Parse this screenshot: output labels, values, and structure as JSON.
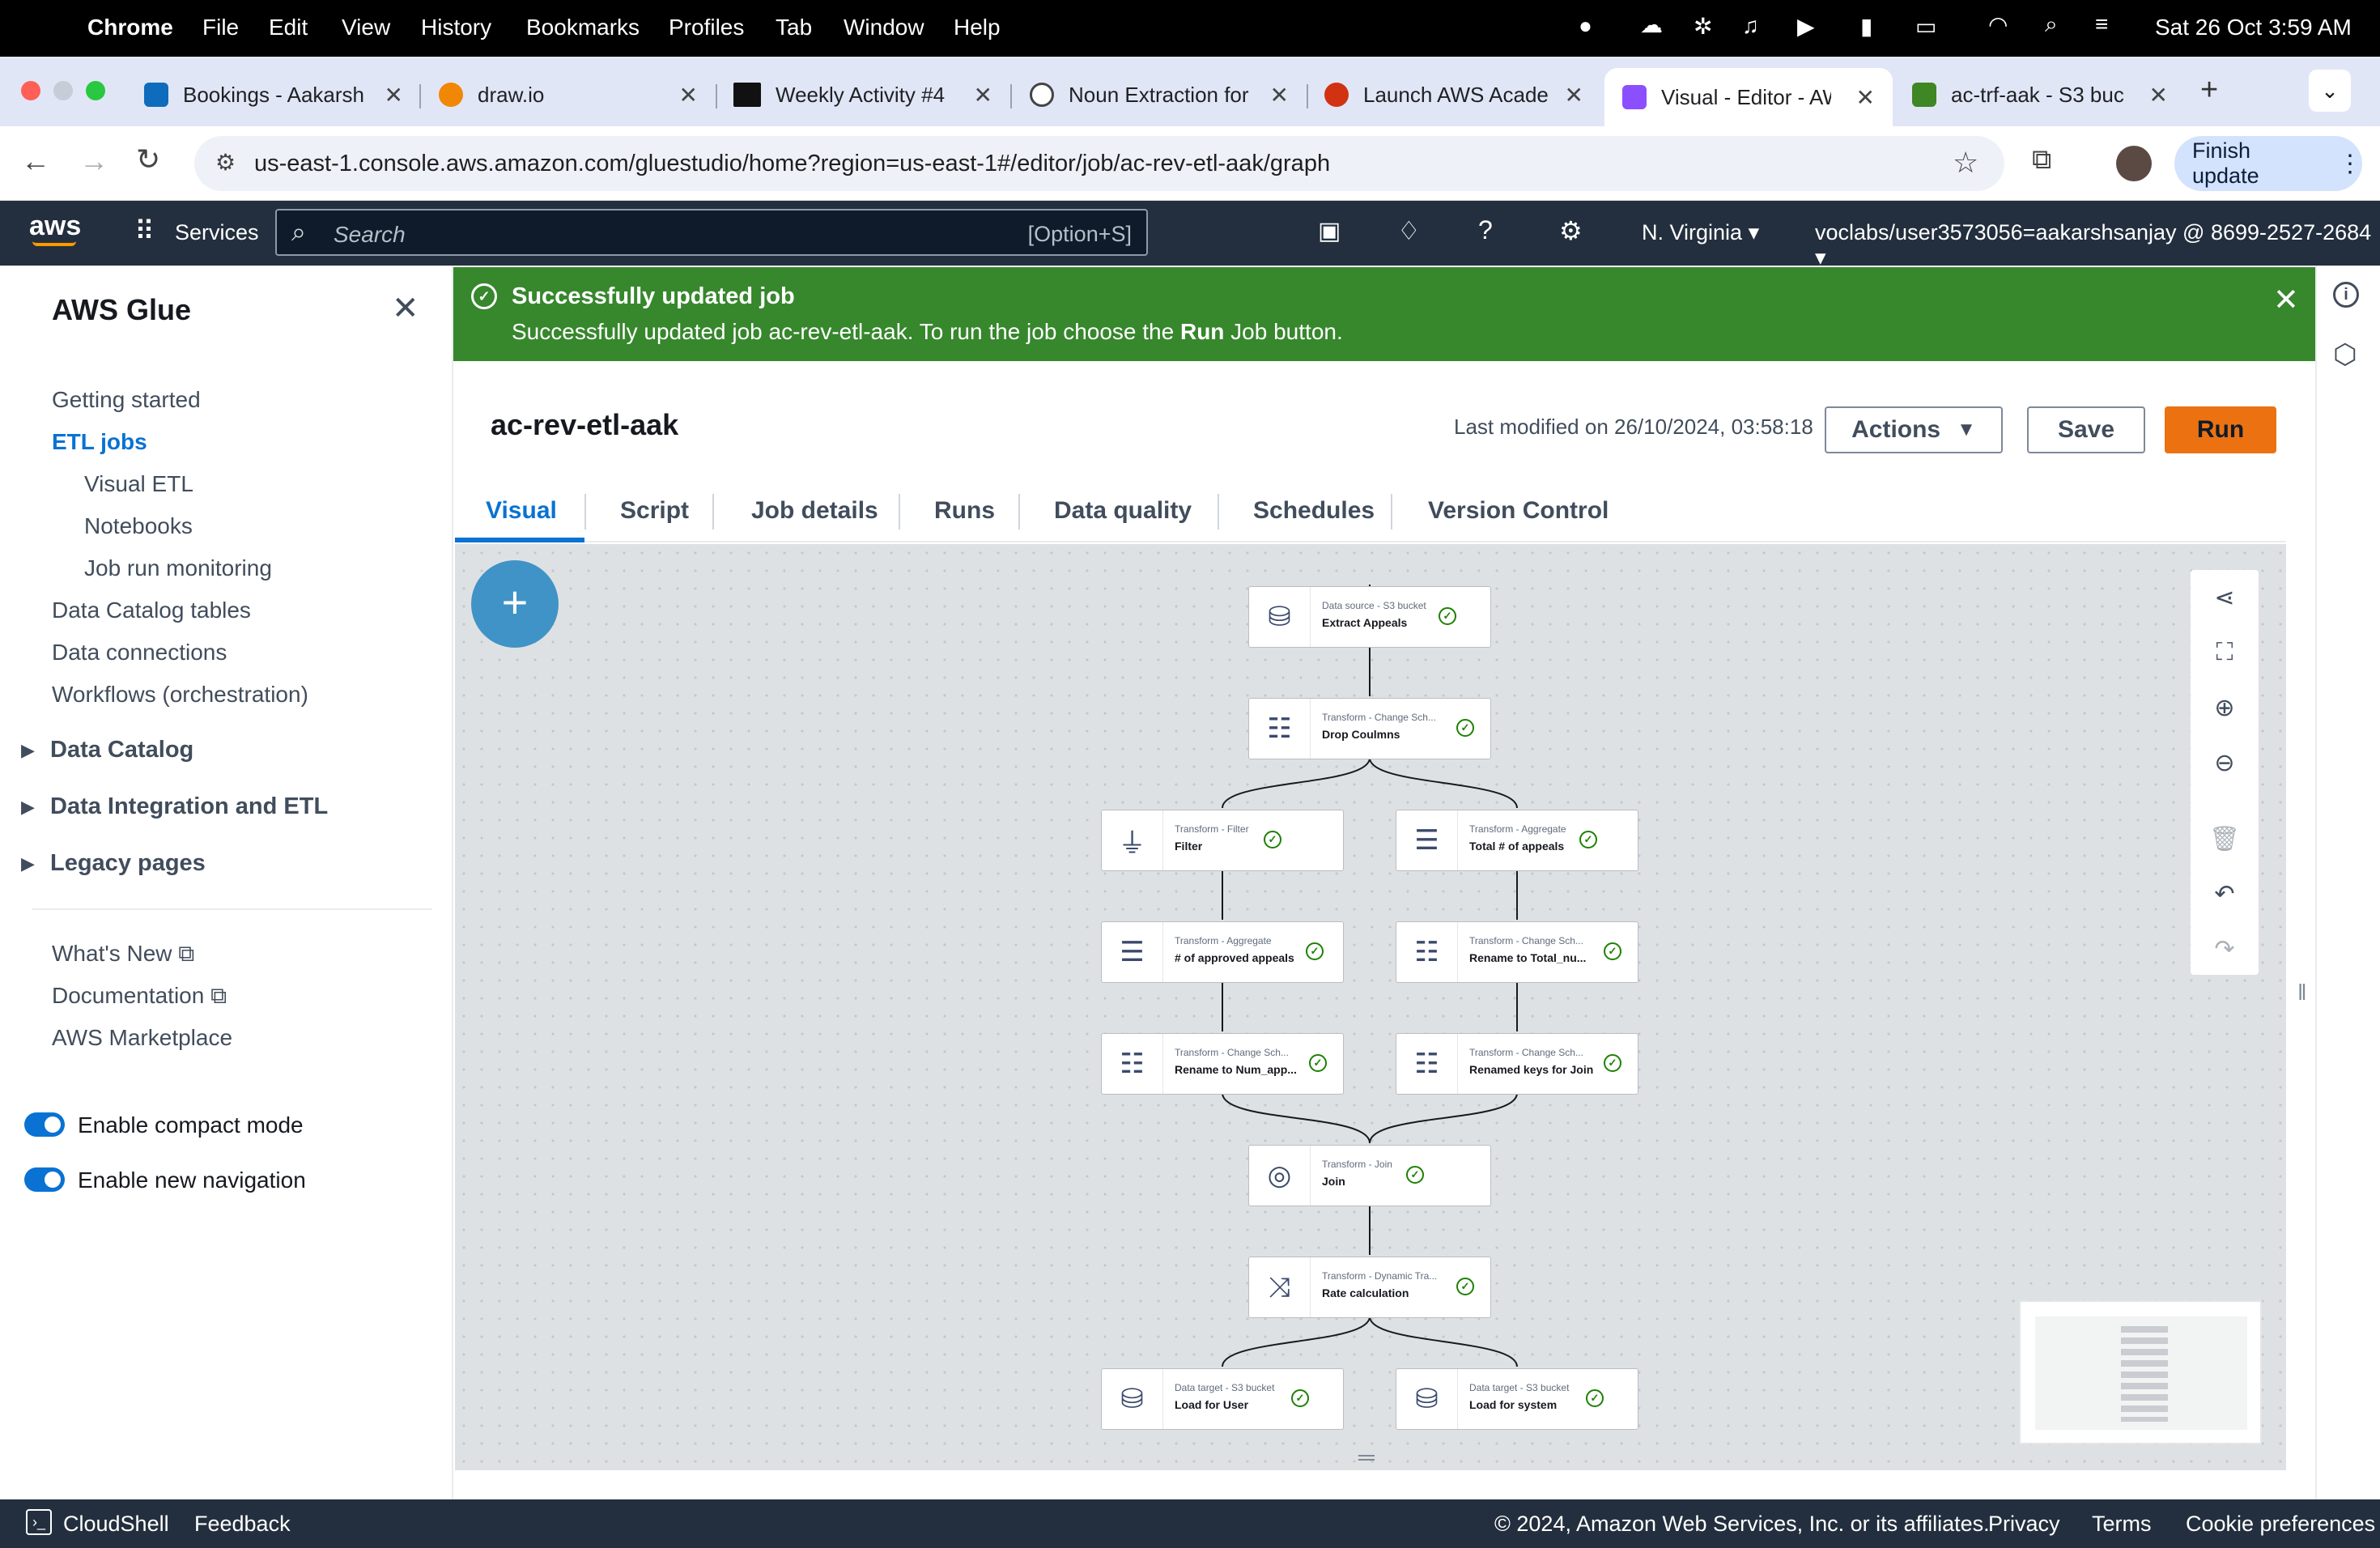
{
  "menubar": {
    "app": "Chrome",
    "items": [
      "File",
      "Edit",
      "View",
      "History",
      "Bookmarks",
      "Profiles",
      "Tab",
      "Window",
      "Help"
    ],
    "clock": "Sat 26 Oct  3:59 AM"
  },
  "browser_tabs": [
    {
      "title": "Bookings - Aakarsh",
      "color": "#0f6cbd"
    },
    {
      "title": "draw.io",
      "color": "#f08705"
    },
    {
      "title": "Weekly Activity #4",
      "color": "#111111"
    },
    {
      "title": "Noun Extraction for",
      "color": "#444444"
    },
    {
      "title": "Launch AWS Acade",
      "color": "#d13212"
    },
    {
      "title": "Visual - Editor - AW",
      "color": "#8c4fff"
    },
    {
      "title": "ac-trf-aak - S3 buc",
      "color": "#3f8624"
    }
  ],
  "address": {
    "url": "us-east-1.console.aws.amazon.com/gluestudio/home?region=us-east-1#/editor/job/ac-rev-etl-aak/graph",
    "finish_update": "Finish update"
  },
  "awsnav": {
    "logo": "aws",
    "services": "Services",
    "search_placeholder": "Search",
    "search_shortcut": "[Option+S]",
    "region": "N. Virginia",
    "account": "voclabs/user3573056=aakarshsanjay @ 8699-2527-2684"
  },
  "sidebar": {
    "title": "AWS Glue",
    "items": [
      "Getting started",
      "ETL jobs",
      "Visual ETL",
      "Notebooks",
      "Job run monitoring",
      "Data Catalog tables",
      "Data connections",
      "Workflows (orchestration)"
    ],
    "groups": [
      "Data Catalog",
      "Data Integration and ETL",
      "Legacy pages"
    ],
    "links": [
      "What's New",
      "Documentation",
      "AWS Marketplace"
    ],
    "toggles": [
      "Enable compact mode",
      "Enable new navigation"
    ]
  },
  "banner": {
    "title": "Successfully updated job",
    "message_pre": "Successfully updated job ac-rev-etl-aak. To run the job choose the ",
    "message_bold": "Run",
    "message_post": " Job button."
  },
  "job": {
    "name": "ac-rev-etl-aak",
    "modified": "Last modified on 26/10/2024, 03:58:18",
    "actions": "Actions",
    "save": "Save",
    "run": "Run"
  },
  "editor_tabs": [
    "Visual",
    "Script",
    "Job details",
    "Runs",
    "Data quality",
    "Schedules",
    "Version Control"
  ],
  "nodes": [
    {
      "type": "Data source - S3 bucket",
      "name": "Extract Appeals",
      "icon": "bucket-icon"
    },
    {
      "type": "Transform - Change Sch...",
      "name": "Drop Coulmns",
      "icon": "schema-icon"
    },
    {
      "type": "Transform - Filter",
      "name": "Filter",
      "icon": "filter-icon"
    },
    {
      "type": "Transform - Aggregate",
      "name": "Total # of appeals",
      "icon": "aggregate-icon"
    },
    {
      "type": "Transform - Aggregate",
      "name": "# of approved appeals",
      "icon": "aggregate-icon"
    },
    {
      "type": "Transform - Change Sch...",
      "name": "Rename to Total_nu...",
      "icon": "schema-icon"
    },
    {
      "type": "Transform - Change Sch...",
      "name": "Rename to Num_app...",
      "icon": "schema-icon"
    },
    {
      "type": "Transform - Change Sch...",
      "name": "Renamed keys for Join",
      "icon": "schema-icon"
    },
    {
      "type": "Transform - Join",
      "name": "Join",
      "icon": "join-icon"
    },
    {
      "type": "Transform - Dynamic Tra...",
      "name": "Rate calculation",
      "icon": "shuffle-icon"
    },
    {
      "type": "Data target - S3 bucket",
      "name": "Load for User",
      "icon": "bucket-icon"
    },
    {
      "type": "Data target - S3 bucket",
      "name": "Load for system",
      "icon": "bucket-icon"
    }
  ],
  "footer": {
    "cloudshell": "CloudShell",
    "feedback": "Feedback",
    "copyright": "© 2024, Amazon Web Services, Inc. or its affiliates.",
    "privacy": "Privacy",
    "terms": "Terms",
    "cookies": "Cookie preferences"
  },
  "colors": {
    "aws_orange": "#ec7211",
    "success_green": "#37872d",
    "link_blue": "#0972d3",
    "aws_nav": "#232f3e"
  }
}
